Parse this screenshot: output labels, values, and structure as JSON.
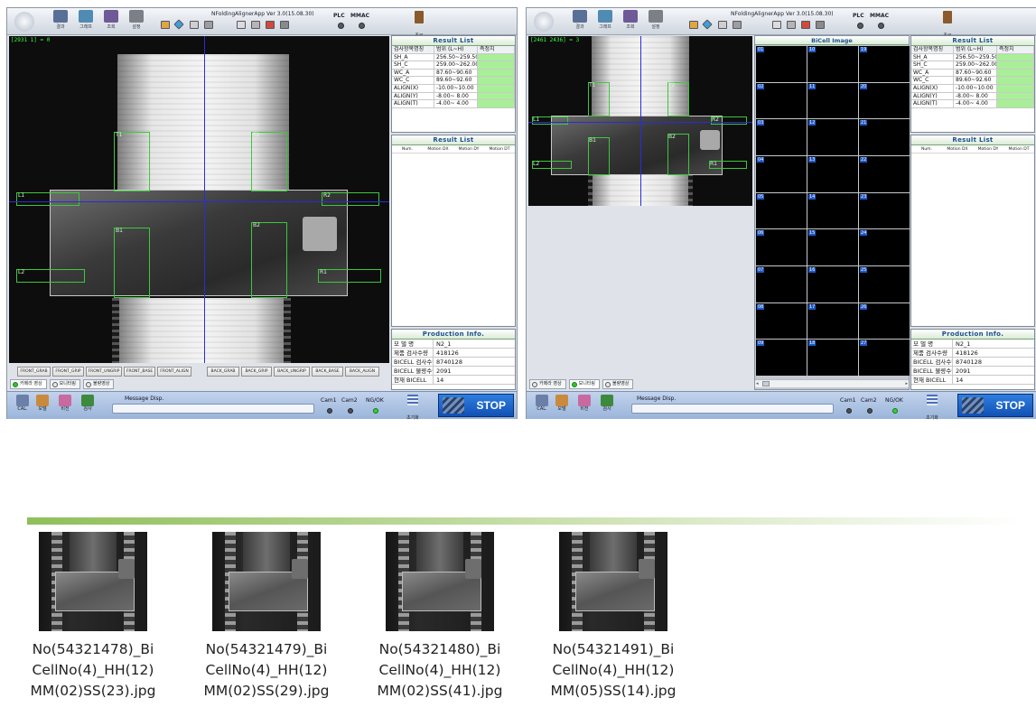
{
  "toolbar": {
    "app_title": "NFoldingAlignerApp Ver 3.0(15.08.30)",
    "buttons": [
      {
        "label": "결과",
        "icon": "result-icon"
      },
      {
        "label": "그래프",
        "icon": "graph-icon"
      },
      {
        "label": "조회",
        "icon": "search-doc-icon"
      },
      {
        "label": "설정",
        "icon": "settings-icon"
      }
    ],
    "plc_label": "PLC",
    "mmac_label": "MMAC",
    "exit_label": "종료"
  },
  "window1": {
    "coord": "[2931 1] = 0",
    "roi_labels": {
      "t1": "T1",
      "t2": "T2",
      "l1": "L1",
      "r2": "R2",
      "b1": "B1",
      "b2": "B2",
      "l2": "L2",
      "r1": "R1"
    },
    "grab_buttons": [
      "FRONT_GRAB",
      "FRONT_GRIP",
      "FRONT_UNGRIP",
      "FRONT_BASE",
      "FRONT_ALIGN",
      "BACK_GRAB",
      "BACK_GRIP",
      "BACK_UNGRIP",
      "BACK_BASE",
      "BACK_ALIGN"
    ]
  },
  "window2": {
    "coord": "[2461 2436] = 3",
    "roi_labels": {
      "t1": "T1",
      "t2": "T2",
      "l1": "L1",
      "r2": "R2",
      "b1": "B1",
      "b2": "B2",
      "l2": "L2",
      "r1": "R1"
    },
    "bicell_title": "BiCell Image",
    "bicell_cells": [
      "01",
      "10",
      "19",
      "02",
      "11",
      "20",
      "03",
      "12",
      "21",
      "04",
      "13",
      "22",
      "05",
      "14",
      "23",
      "06",
      "15",
      "24",
      "07",
      "16",
      "25",
      "08",
      "17",
      "26",
      "09",
      "18",
      "27"
    ]
  },
  "result_list": {
    "title": "Result List",
    "headers": [
      "검사항목명칭",
      "범위 (L~H)",
      "측정치"
    ],
    "rows": [
      {
        "name": "SH_A",
        "range": "256.50~259.50"
      },
      {
        "name": "SH_C",
        "range": "259.00~262.00"
      },
      {
        "name": "WC_A",
        "range": "87.60~90.60"
      },
      {
        "name": "WC_C",
        "range": "89.60~92.60"
      },
      {
        "name": "ALIGN(X)",
        "range": "-10.00~10.00"
      },
      {
        "name": "ALIGN(Y)",
        "range": "-8.00~ 8.00"
      },
      {
        "name": "ALIGN(T)",
        "range": "-4.00~ 4.00"
      }
    ]
  },
  "motion_list": {
    "title": "Result List",
    "headers": [
      "Num.",
      "Motion DX",
      "Motion DY",
      "Motion DT"
    ]
  },
  "production": {
    "title": "Production Info.",
    "rows": [
      {
        "key": "모 델 명",
        "value": "N2_1"
      },
      {
        "key": "제품 검사수량",
        "value": "418126"
      },
      {
        "key": "BICELL 검사수량",
        "value": "8740128"
      },
      {
        "key": "BICELL 불량수량",
        "value": "2091"
      },
      {
        "key": "현재 BICELL",
        "value": "14"
      }
    ]
  },
  "tabs": [
    "카메라 영상",
    "모니터링",
    "불량영상"
  ],
  "status_bar": {
    "buttons": [
      {
        "label": "CAL.",
        "icon": "calibration-icon"
      },
      {
        "label": "모델",
        "icon": "model-icon"
      },
      {
        "label": "비전",
        "icon": "vision-icon"
      },
      {
        "label": "검사",
        "icon": "inspect-icon"
      }
    ],
    "message_label": "Message Disp.",
    "cam1": "Cam1",
    "cam2": "Cam2",
    "ngok": "NG/OK",
    "reset_label": "초기화",
    "stop_label": "STOP"
  },
  "files": [
    {
      "name": "No(54321478)_BiCellNo(4)_HH(12)MM(02)SS(23).jpg"
    },
    {
      "name": "No(54321479)_BiCellNo(4)_HH(12)MM(02)SS(29).jpg"
    },
    {
      "name": "No(54321480)_BiCellNo(4)_HH(12)MM(02)SS(41).jpg"
    },
    {
      "name": "No(54321491)_BiCellNo(4)_HH(12)MM(05)SS(14).jpg"
    }
  ],
  "colors": {
    "measure_ok": "#a9ef98",
    "roi": "#3cc83c",
    "stop": "#1150b4",
    "header_text": "#1e4f8c"
  }
}
